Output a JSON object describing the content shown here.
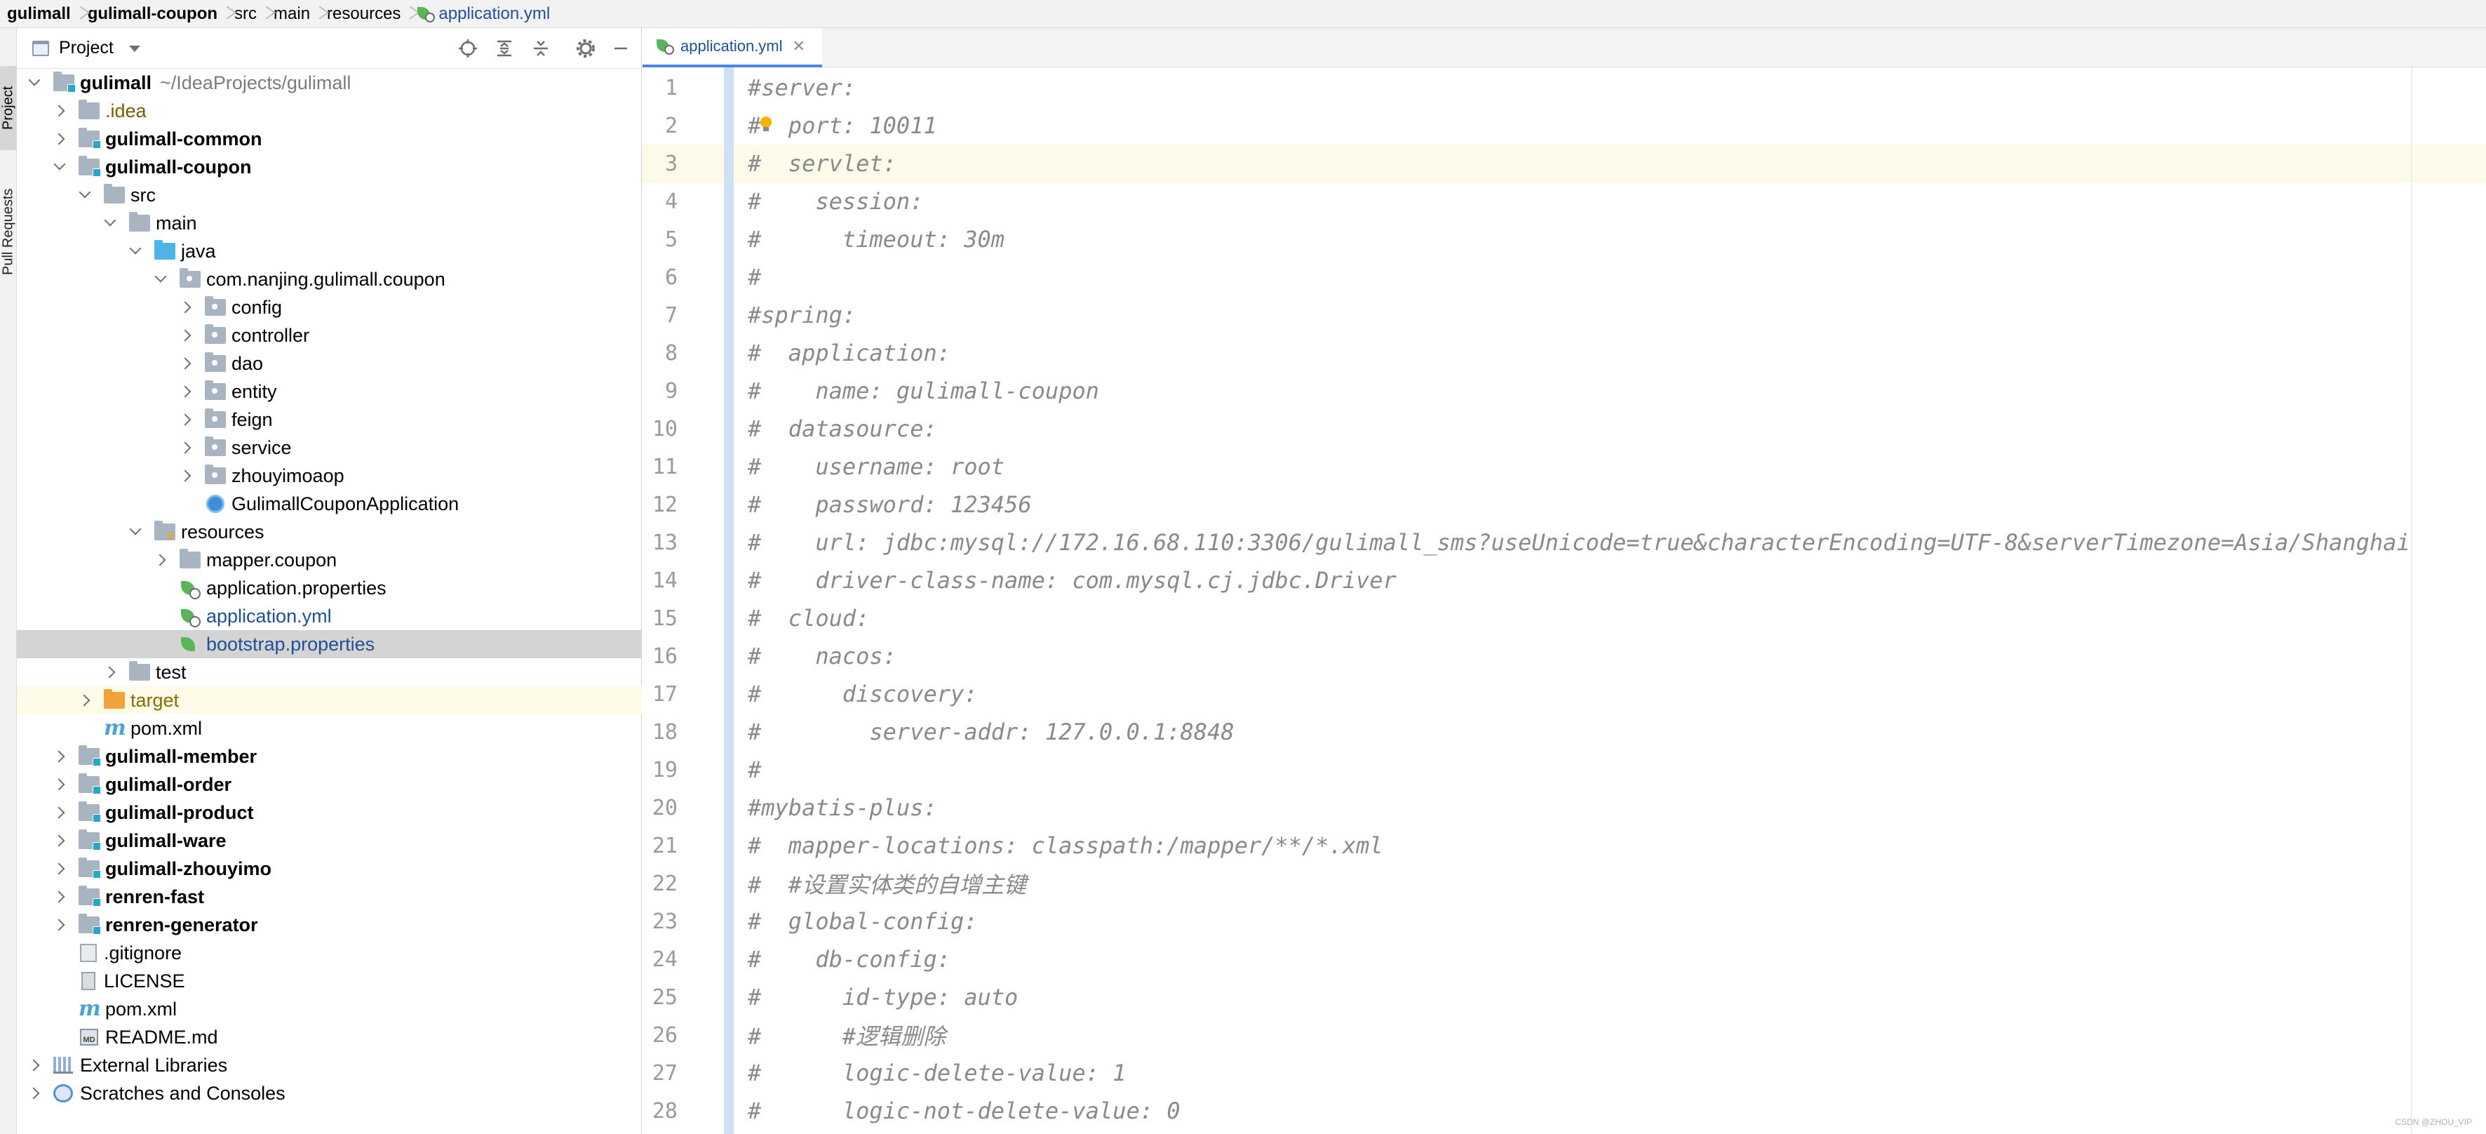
{
  "breadcrumb": [
    "gulimall",
    "gulimall-coupon",
    "src",
    "main",
    "resources",
    "application.yml"
  ],
  "tool_strip": {
    "project": "Project",
    "pull_requests": "Pull Requests"
  },
  "panel": {
    "title": "Project"
  },
  "tree": [
    {
      "depth": 0,
      "arrow": "down",
      "icon": "module",
      "label": "gulimall",
      "hint": "~/IdeaProjects/gulimall",
      "bold": true
    },
    {
      "depth": 1,
      "arrow": "right",
      "icon": "folder",
      "label": ".idea",
      "style": "brown"
    },
    {
      "depth": 1,
      "arrow": "right",
      "icon": "module",
      "label": "gulimall-common",
      "bold": true
    },
    {
      "depth": 1,
      "arrow": "down",
      "icon": "module",
      "label": "gulimall-coupon",
      "bold": true
    },
    {
      "depth": 2,
      "arrow": "down",
      "icon": "folder",
      "label": "src"
    },
    {
      "depth": 3,
      "arrow": "down",
      "icon": "folder",
      "label": "main"
    },
    {
      "depth": 4,
      "arrow": "down",
      "icon": "java",
      "label": "java"
    },
    {
      "depth": 5,
      "arrow": "down",
      "icon": "pkg",
      "label": "com.nanjing.gulimall.coupon"
    },
    {
      "depth": 6,
      "arrow": "right",
      "icon": "pkg",
      "label": "config"
    },
    {
      "depth": 6,
      "arrow": "right",
      "icon": "pkg",
      "label": "controller"
    },
    {
      "depth": 6,
      "arrow": "right",
      "icon": "pkg",
      "label": "dao"
    },
    {
      "depth": 6,
      "arrow": "right",
      "icon": "pkg",
      "label": "entity"
    },
    {
      "depth": 6,
      "arrow": "right",
      "icon": "pkg",
      "label": "feign"
    },
    {
      "depth": 6,
      "arrow": "right",
      "icon": "pkg",
      "label": "service"
    },
    {
      "depth": 6,
      "arrow": "right",
      "icon": "pkg",
      "label": "zhouyimoaop"
    },
    {
      "depth": 6,
      "arrow": "none",
      "icon": "class",
      "label": "GulimallCouponApplication"
    },
    {
      "depth": 4,
      "arrow": "down",
      "icon": "res",
      "label": "resources"
    },
    {
      "depth": 5,
      "arrow": "right",
      "icon": "folder",
      "label": "mapper.coupon"
    },
    {
      "depth": 5,
      "arrow": "none",
      "icon": "leaf",
      "label": "application.properties"
    },
    {
      "depth": 5,
      "arrow": "none",
      "icon": "leaf",
      "label": "application.yml",
      "style": "blue"
    },
    {
      "depth": 5,
      "arrow": "none",
      "icon": "leafplain",
      "label": "bootstrap.properties",
      "style": "blue",
      "selected": true
    },
    {
      "depth": 3,
      "arrow": "right",
      "icon": "folder",
      "label": "test"
    },
    {
      "depth": 2,
      "arrow": "right",
      "icon": "target",
      "label": "target",
      "style": "orange",
      "yellow": true
    },
    {
      "depth": 2,
      "arrow": "none",
      "icon": "maven",
      "label": "pom.xml"
    },
    {
      "depth": 1,
      "arrow": "right",
      "icon": "module",
      "label": "gulimall-member",
      "bold": true
    },
    {
      "depth": 1,
      "arrow": "right",
      "icon": "module",
      "label": "gulimall-order",
      "bold": true
    },
    {
      "depth": 1,
      "arrow": "right",
      "icon": "module",
      "label": "gulimall-product",
      "bold": true
    },
    {
      "depth": 1,
      "arrow": "right",
      "icon": "module",
      "label": "gulimall-ware",
      "bold": true
    },
    {
      "depth": 1,
      "arrow": "right",
      "icon": "module",
      "label": "gulimall-zhouyimo",
      "bold": true
    },
    {
      "depth": 1,
      "arrow": "right",
      "icon": "module",
      "label": "renren-fast",
      "bold": true
    },
    {
      "depth": 1,
      "arrow": "right",
      "icon": "module",
      "label": "renren-generator",
      "bold": true
    },
    {
      "depth": 1,
      "arrow": "none",
      "icon": "git",
      "label": ".gitignore"
    },
    {
      "depth": 1,
      "arrow": "none",
      "icon": "file",
      "label": "LICENSE"
    },
    {
      "depth": 1,
      "arrow": "none",
      "icon": "maven",
      "label": "pom.xml"
    },
    {
      "depth": 1,
      "arrow": "none",
      "icon": "md",
      "label": "README.md"
    },
    {
      "depth": 0,
      "arrow": "right",
      "icon": "lib",
      "label": "External Libraries"
    },
    {
      "depth": 0,
      "arrow": "right",
      "icon": "scratch",
      "label": "Scratches and Consoles"
    }
  ],
  "editor": {
    "tab_label": "application.yml",
    "current_line": 3,
    "lines": [
      "#server:",
      "#  port: 10011",
      "#  servlet:",
      "#    session:",
      "#      timeout: 30m",
      "#",
      "#spring:",
      "#  application:",
      "#    name: gulimall-coupon",
      "#  datasource:",
      "#    username: root",
      "#    password: 123456",
      "#    url: jdbc:mysql://172.16.68.110:3306/gulimall_sms?useUnicode=true&characterEncoding=UTF-8&serverTimezone=Asia/Shanghai",
      "#    driver-class-name: com.mysql.cj.jdbc.Driver",
      "#  cloud:",
      "#    nacos:",
      "#      discovery:",
      "#        server-addr: 127.0.0.1:8848",
      "#",
      "#mybatis-plus:",
      "#  mapper-locations: classpath:/mapper/**/*.xml",
      "#  #设置实体类的自增主键",
      "#  global-config:",
      "#    db-config:",
      "#      id-type: auto",
      "#      #逻辑删除",
      "#      logic-delete-value: 1",
      "#      logic-not-delete-value: 0"
    ]
  },
  "watermark": "CSDN @ZHOU_VIP"
}
